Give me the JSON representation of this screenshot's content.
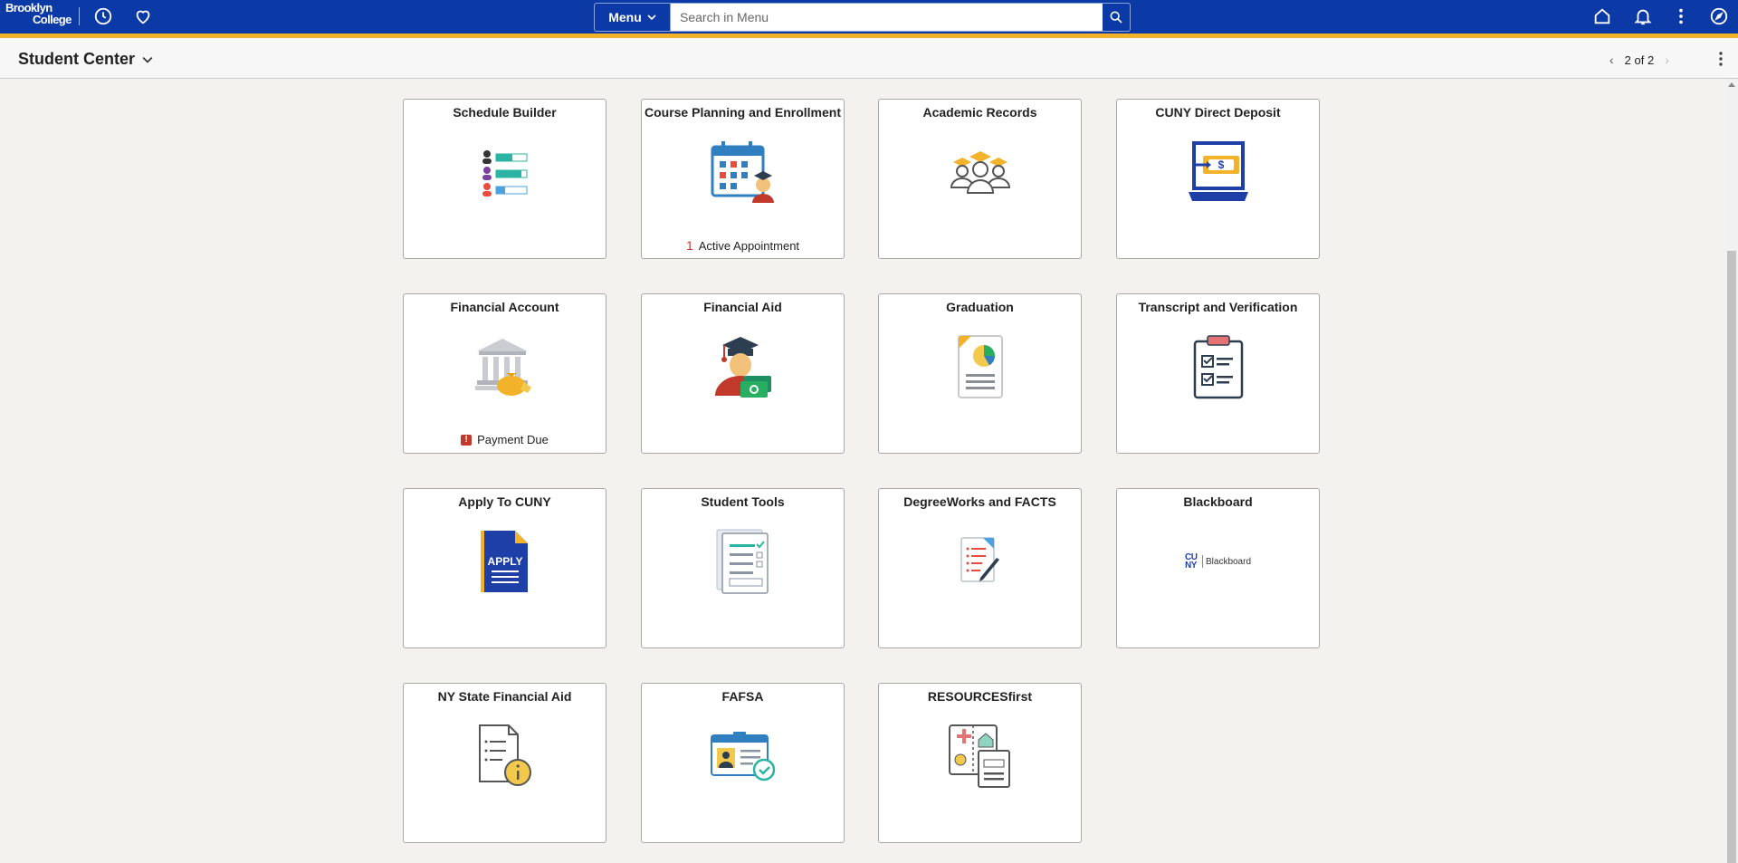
{
  "header": {
    "logo_line1": "Brooklyn",
    "logo_line2": "College",
    "menu_label": "Menu",
    "search_placeholder": "Search in Menu",
    "icons": [
      "history-icon",
      "favorites-icon",
      "home-icon",
      "notifications-icon",
      "actions-icon",
      "navigator-icon"
    ]
  },
  "subheader": {
    "title": "Student Center",
    "pager_text": "2 of 2"
  },
  "tiles": [
    {
      "title": "Schedule Builder",
      "status": ""
    },
    {
      "title": "Course Planning and Enrollment",
      "count": "1",
      "status": "Active Appointment"
    },
    {
      "title": "Academic Records",
      "status": ""
    },
    {
      "title": "CUNY Direct Deposit",
      "status": ""
    },
    {
      "title": "Financial Account",
      "badge": "!",
      "status": "Payment Due"
    },
    {
      "title": "Financial Aid",
      "status": ""
    },
    {
      "title": "Graduation",
      "status": ""
    },
    {
      "title": "Transcript and Verification",
      "status": ""
    },
    {
      "title": "Apply To CUNY",
      "status": "",
      "icon_text": "APPLY"
    },
    {
      "title": "Student Tools",
      "status": ""
    },
    {
      "title": "DegreeWorks and FACTS",
      "status": ""
    },
    {
      "title": "Blackboard",
      "status": "",
      "logo_cuny": "CUNY",
      "logo_text": "Blackboard"
    },
    {
      "title": "NY State Financial Aid",
      "status": ""
    },
    {
      "title": "FAFSA",
      "status": ""
    },
    {
      "title": "RESOURCESfirst",
      "status": ""
    }
  ],
  "colors": {
    "banner": "#0b3aa6",
    "accent_stripe": "#f2b32b",
    "alert": "#c0392b"
  }
}
